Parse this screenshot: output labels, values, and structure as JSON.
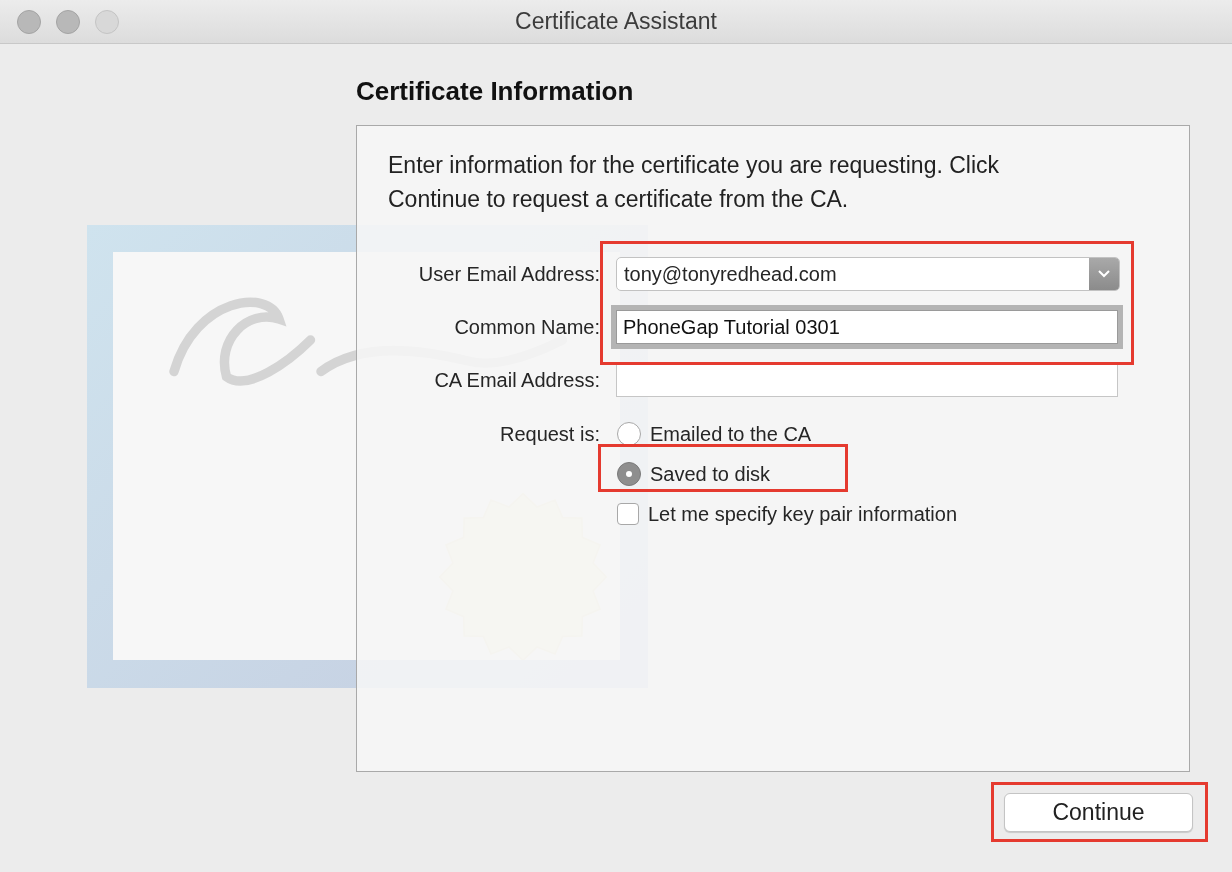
{
  "window": {
    "title": "Certificate Assistant"
  },
  "heading": "Certificate Information",
  "intro": "Enter information for the certificate you are requesting. Click Continue to request a certificate from the CA.",
  "fields": [
    {
      "kind": "popup",
      "label": "User Email Address:",
      "value": "tony@tonyredhead.com",
      "highlighted": true
    },
    {
      "kind": "text",
      "label": "Common Name:",
      "value": "PhoneGap Tutorial 0301",
      "focused": true,
      "highlighted": true
    },
    {
      "kind": "text",
      "label": "CA Email Address:",
      "focused": false,
      "highlighted": false
    }
  ],
  "request": {
    "label": "Request is:",
    "options": [
      {
        "label": "Emailed to the CA",
        "selected": false,
        "highlighted": false
      },
      {
        "label": "Saved to disk",
        "selected": true,
        "highlighted": true
      }
    ],
    "key_pair": {
      "label": "Let me specify key pair information",
      "checked": false
    }
  },
  "buttons": [
    {
      "label": "Continue",
      "highlighted": true
    }
  ]
}
